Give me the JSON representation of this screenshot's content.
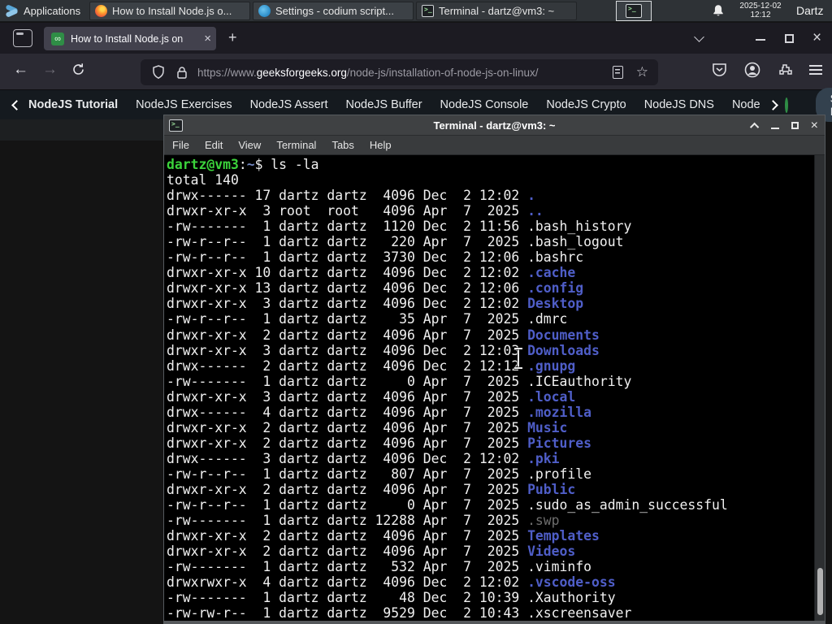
{
  "colors": {
    "accent_green": "#2f8d46",
    "prompt_green": "#3bd33b",
    "dir_blue": "#4f5ec8",
    "cwd_blue": "#7286c0",
    "page_bg": "#141414"
  },
  "panel": {
    "applications_label": "Applications",
    "windows": [
      {
        "icon": "firefox",
        "title": "How to Install Node.js o..."
      },
      {
        "icon": "codium",
        "title": "Settings - codium script..."
      },
      {
        "icon": "terminal",
        "title": "Terminal - dartz@vm3: ~"
      }
    ],
    "clock_date": "2025-12-02",
    "clock_time": "12:12",
    "user_label": "Dartz"
  },
  "browser": {
    "tab_title": "How to Install Node.js on",
    "favicon_glyph": "∞",
    "close_glyph": "×",
    "new_tab_glyph": "+",
    "back_glyph": "←",
    "forward_glyph": "→",
    "url_scheme": "https://www.",
    "url_domain": "geeksforgeeks.org",
    "url_path": "/node-js/installation-of-node-js-on-linux/",
    "star_glyph": "☆",
    "window_close_glyph": "×"
  },
  "site_nav": {
    "items": [
      "NodeJS Tutorial",
      "NodeJS Exercises",
      "NodeJS Assert",
      "NodeJS Buffer",
      "NodeJS Console",
      "NodeJS Crypto",
      "NodeJS DNS",
      "Node"
    ],
    "sign_in_label": "Sign In"
  },
  "terminal": {
    "title": "Terminal - dartz@vm3: ~",
    "close_glyph": "×",
    "menu": [
      "File",
      "Edit",
      "View",
      "Terminal",
      "Tabs",
      "Help"
    ],
    "prompt": {
      "user_host": "dartz@vm3",
      "colon": ":",
      "cwd": "~",
      "rest": "$ ls -la"
    },
    "total_line": "total 140",
    "listing": [
      {
        "meta": "drwx------ 17 dartz dartz  4096 Dec  2 12:02 ",
        "name": ".",
        "kind": "dir"
      },
      {
        "meta": "drwxr-xr-x  3 root  root   4096 Apr  7  2025 ",
        "name": "..",
        "kind": "dir"
      },
      {
        "meta": "-rw-------  1 dartz dartz  1120 Dec  2 11:56 ",
        "name": ".bash_history",
        "kind": "file"
      },
      {
        "meta": "-rw-r--r--  1 dartz dartz   220 Apr  7  2025 ",
        "name": ".bash_logout",
        "kind": "file"
      },
      {
        "meta": "-rw-r--r--  1 dartz dartz  3730 Dec  2 12:06 ",
        "name": ".bashrc",
        "kind": "file"
      },
      {
        "meta": "drwxr-xr-x 10 dartz dartz  4096 Dec  2 12:02 ",
        "name": ".cache",
        "kind": "dir"
      },
      {
        "meta": "drwxr-xr-x 13 dartz dartz  4096 Dec  2 12:06 ",
        "name": ".config",
        "kind": "dir"
      },
      {
        "meta": "drwxr-xr-x  3 dartz dartz  4096 Dec  2 12:02 ",
        "name": "Desktop",
        "kind": "dir"
      },
      {
        "meta": "-rw-r--r--  1 dartz dartz    35 Apr  7  2025 ",
        "name": ".dmrc",
        "kind": "file"
      },
      {
        "meta": "drwxr-xr-x  2 dartz dartz  4096 Apr  7  2025 ",
        "name": "Documents",
        "kind": "dir"
      },
      {
        "meta": "drwxr-xr-x  3 dartz dartz  4096 Dec  2 12:03 ",
        "name": "Downloads",
        "kind": "dir"
      },
      {
        "meta": "drwx------  2 dartz dartz  4096 Dec  2 12:12 ",
        "name": ".gnupg",
        "kind": "dir"
      },
      {
        "meta": "-rw-------  1 dartz dartz     0 Apr  7  2025 ",
        "name": ".ICEauthority",
        "kind": "file"
      },
      {
        "meta": "drwxr-xr-x  3 dartz dartz  4096 Apr  7  2025 ",
        "name": ".local",
        "kind": "dir"
      },
      {
        "meta": "drwx------  4 dartz dartz  4096 Apr  7  2025 ",
        "name": ".mozilla",
        "kind": "dir"
      },
      {
        "meta": "drwxr-xr-x  2 dartz dartz  4096 Apr  7  2025 ",
        "name": "Music",
        "kind": "dir"
      },
      {
        "meta": "drwxr-xr-x  2 dartz dartz  4096 Apr  7  2025 ",
        "name": "Pictures",
        "kind": "dir"
      },
      {
        "meta": "drwx------  3 dartz dartz  4096 Dec  2 12:02 ",
        "name": ".pki",
        "kind": "dir"
      },
      {
        "meta": "-rw-r--r--  1 dartz dartz   807 Apr  7  2025 ",
        "name": ".profile",
        "kind": "file"
      },
      {
        "meta": "drwxr-xr-x  2 dartz dartz  4096 Apr  7  2025 ",
        "name": "Public",
        "kind": "dir"
      },
      {
        "meta": "-rw-r--r--  1 dartz dartz     0 Apr  7  2025 ",
        "name": ".sudo_as_admin_successful",
        "kind": "file"
      },
      {
        "meta": "-rw-------  1 dartz dartz 12288 Apr  7  2025 ",
        "name": ".swp",
        "kind": "dim"
      },
      {
        "meta": "drwxr-xr-x  2 dartz dartz  4096 Apr  7  2025 ",
        "name": "Templates",
        "kind": "dir"
      },
      {
        "meta": "drwxr-xr-x  2 dartz dartz  4096 Apr  7  2025 ",
        "name": "Videos",
        "kind": "dir"
      },
      {
        "meta": "-rw-------  1 dartz dartz   532 Apr  7  2025 ",
        "name": ".viminfo",
        "kind": "file"
      },
      {
        "meta": "drwxrwxr-x  4 dartz dartz  4096 Dec  2 12:02 ",
        "name": ".vscode-oss",
        "kind": "dir"
      },
      {
        "meta": "-rw-------  1 dartz dartz    48 Dec  2 10:39 ",
        "name": ".Xauthority",
        "kind": "file"
      },
      {
        "meta": "-rw-rw-r--  1 dartz dartz  9529 Dec  2 10:43 ",
        "name": ".xscreensaver",
        "kind": "file"
      }
    ]
  }
}
